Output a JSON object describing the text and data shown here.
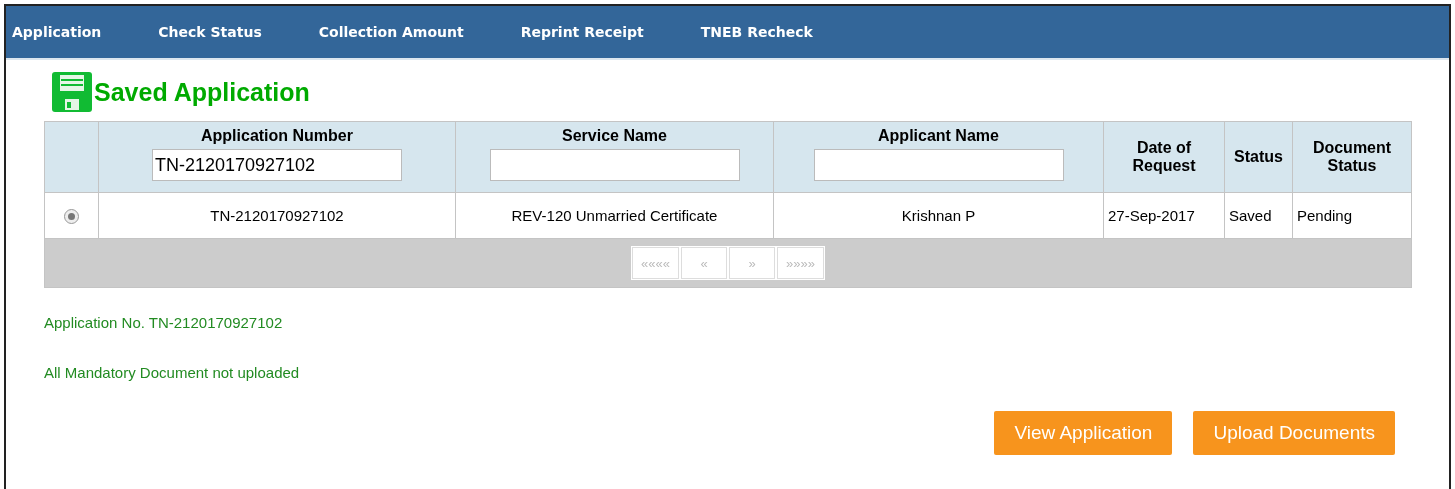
{
  "nav": {
    "items": [
      {
        "label": "Application"
      },
      {
        "label": "Check Status"
      },
      {
        "label": "Collection Amount"
      },
      {
        "label": "Reprint Receipt"
      },
      {
        "label": "TNEB Recheck"
      }
    ]
  },
  "panel": {
    "title": "Saved Application",
    "table": {
      "columns": [
        {
          "label": "Application Number",
          "filter": true,
          "value": "TN-2120170927102"
        },
        {
          "label": "Service Name",
          "filter": true
        },
        {
          "label": "Applicant Name",
          "filter": true
        },
        {
          "label": "Date of Request",
          "filter": false
        },
        {
          "label": "Status",
          "filter": false
        },
        {
          "label": "Document Status",
          "filter": false
        }
      ],
      "rows": [
        {
          "selected": true,
          "cells": [
            "TN-2120170927102",
            "REV-120 Unmarried Certificate",
            "Krishnan P",
            "27-Sep-2017",
            "Saved",
            "Pending"
          ]
        }
      ],
      "pager": [
        {
          "label": "««««",
          "disabled": true
        },
        {
          "label": "«",
          "disabled": true
        },
        {
          "label": "»",
          "disabled": true
        },
        {
          "label": "»»»»",
          "disabled": true
        }
      ]
    },
    "messages": [
      "Application No. TN-2120170927102",
      "All Mandatory Document not uploaded"
    ],
    "buttons": [
      "View Application",
      "Upload Documents"
    ]
  }
}
